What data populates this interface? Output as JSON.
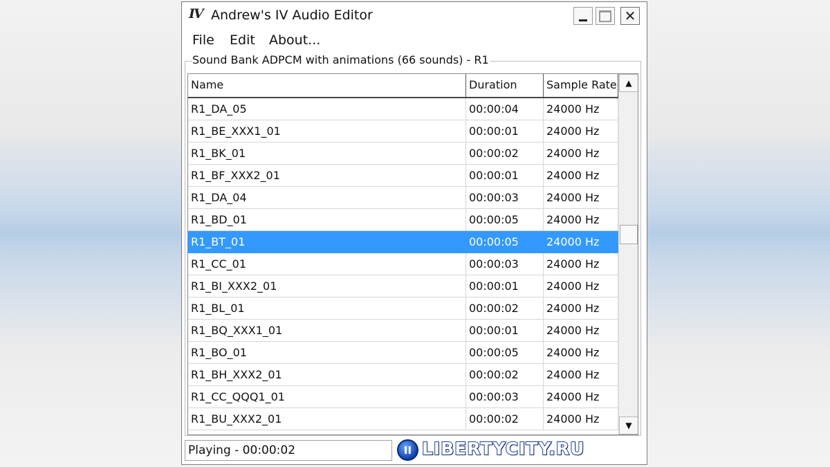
{
  "window": {
    "title": "Andrew's IV Audio Editor",
    "icon_glyph": "IV",
    "controls": {
      "minimize": "",
      "maximize": "",
      "close": "✕"
    }
  },
  "menu": [
    "File",
    "Edit",
    "About..."
  ],
  "group": {
    "label": "Sound Bank ADPCM with animations (66 sounds) - R1"
  },
  "list": {
    "columns": [
      "Name",
      "Duration",
      "Sample Rate"
    ],
    "selected_index": 6,
    "rows": [
      [
        "R1_DA_05",
        "00:00:04",
        "24000 Hz"
      ],
      [
        "R1_BE_XXX1_01",
        "00:00:01",
        "24000 Hz"
      ],
      [
        "R1_BK_01",
        "00:00:02",
        "24000 Hz"
      ],
      [
        "R1_BF_XXX2_01",
        "00:00:01",
        "24000 Hz"
      ],
      [
        "R1_DA_04",
        "00:00:03",
        "24000 Hz"
      ],
      [
        "R1_BD_01",
        "00:00:05",
        "24000 Hz"
      ],
      [
        "R1_BT_01",
        "00:00:05",
        "24000 Hz"
      ],
      [
        "R1_CC_01",
        "00:00:03",
        "24000 Hz"
      ],
      [
        "R1_BI_XXX2_01",
        "00:00:01",
        "24000 Hz"
      ],
      [
        "R1_BL_01",
        "00:00:02",
        "24000 Hz"
      ],
      [
        "R1_BQ_XXX1_01",
        "00:00:01",
        "24000 Hz"
      ],
      [
        "R1_BO_01",
        "00:00:05",
        "24000 Hz"
      ],
      [
        "R1_BH_XXX2_01",
        "00:00:02",
        "24000 Hz"
      ],
      [
        "R1_CC_QQQ1_01",
        "00:00:03",
        "24000 Hz"
      ],
      [
        "R1_BU_XXX2_01",
        "00:00:02",
        "24000 Hz"
      ]
    ],
    "scroll_up_icon": "▲",
    "scroll_down_icon": "▼"
  },
  "status": {
    "text": "Playing - 00:00:02"
  },
  "watermark": {
    "text": "LIBERTYCITY.RU",
    "badge": "II"
  },
  "colors": {
    "selection": "#3399ff",
    "watermark_blue": "#1a3f99"
  }
}
